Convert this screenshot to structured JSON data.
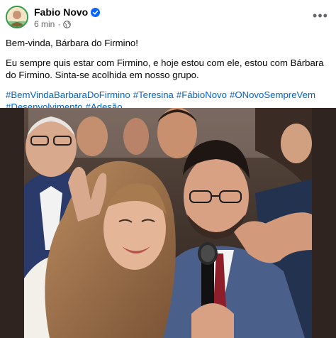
{
  "post": {
    "author": "Fabio Novo",
    "verified_icon": "verified-badge-icon",
    "timestamp": "6 min",
    "separator": "·",
    "audience_icon": "globe-icon",
    "more_icon": "more-options-icon",
    "more_glyph": "•••",
    "paragraphs": [
      "Bem-vinda, Bárbara do Firmino!",
      "Eu sempre quis estar com Firmino, e hoje estou com ele, estou com Bárbara do Firmino. Sinta-se acolhida em nosso grupo."
    ],
    "hashtags": [
      "#BemVindaBarbaraDoFirmino",
      "#Teresina",
      "#FábioNovo",
      "#ONovoSempreVem",
      "#Desenvolvimento",
      "#Adesão"
    ],
    "photo_alt": ""
  },
  "colors": {
    "link": "#0064d1",
    "verified": "#0866ff",
    "secondary_text": "#65676b"
  }
}
